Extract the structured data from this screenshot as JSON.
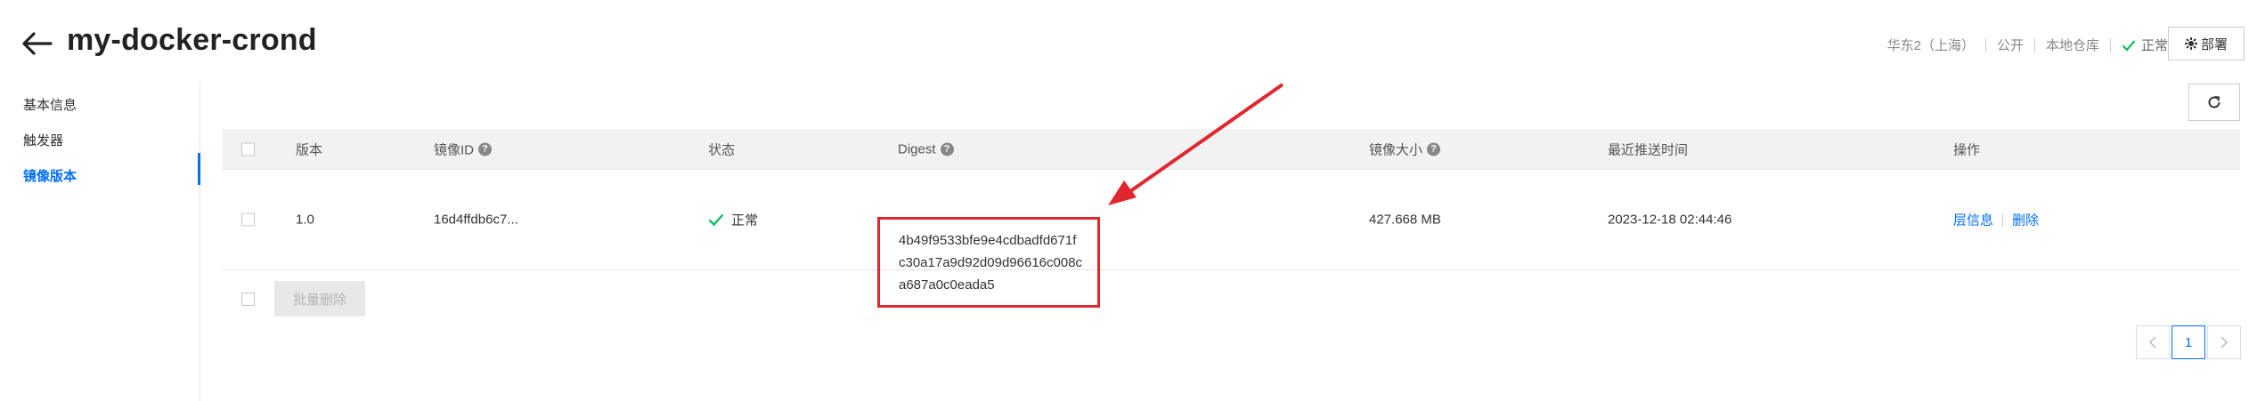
{
  "header": {
    "title": "my-docker-crond",
    "region": "华东2（上海）",
    "visibility": "公开",
    "repo_type": "本地仓库",
    "status": "正常",
    "deploy_label": "部署"
  },
  "sidebar": {
    "items": [
      {
        "label": "基本信息"
      },
      {
        "label": "触发器"
      },
      {
        "label": "镜像版本"
      }
    ],
    "active_index": 2
  },
  "table": {
    "columns": {
      "version": "版本",
      "image_id": "镜像ID",
      "status": "状态",
      "digest": "Digest",
      "size": "镜像大小",
      "pushed": "最近推送时间",
      "ops": "操作"
    },
    "rows": [
      {
        "version": "1.0",
        "image_id": "16d4ffdb6c7...",
        "status": "正常",
        "digest_lines": [
          "4b49f9533bfe9e4cdbadfd671f",
          "c30a17a9d92d09d96616c008c",
          "a687a0c0eada5"
        ],
        "size": "427.668 MB",
        "pushed": "2023-12-18 02:44:46",
        "op_layers": "层信息",
        "op_delete": "删除"
      }
    ]
  },
  "footer": {
    "batch_delete": "批量删除"
  },
  "pagination": {
    "current": "1"
  },
  "colors": {
    "accent": "#006eff",
    "success": "#0abf5b",
    "annotation": "#e1262f"
  },
  "icons": [
    "back-arrow-icon",
    "check-icon",
    "deploy-icon",
    "refresh-icon",
    "help-icon",
    "chevron-left-icon",
    "chevron-right-icon"
  ]
}
